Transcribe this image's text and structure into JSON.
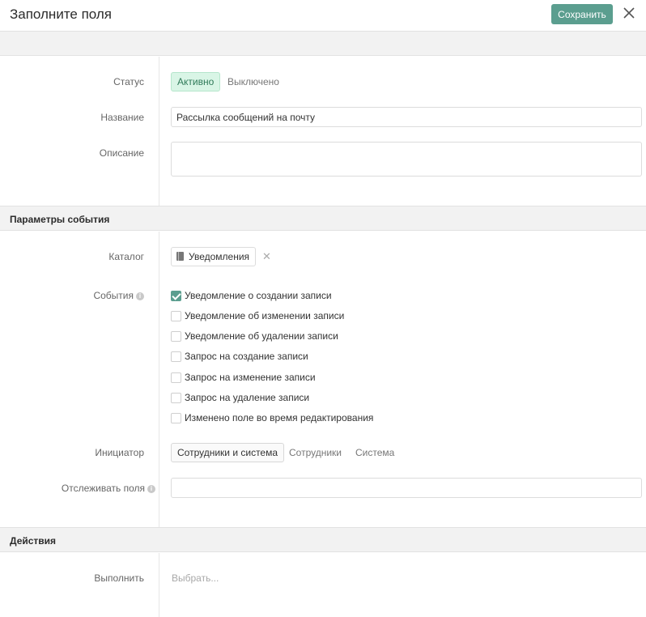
{
  "header": {
    "title": "Заполните поля",
    "save_label": "Сохранить",
    "close_icon": "close-icon"
  },
  "main": {
    "status": {
      "label": "Статус",
      "options": [
        "Активно",
        "Выключено"
      ],
      "selected": "Активно"
    },
    "name": {
      "label": "Название",
      "value": "Рассылка сообщений на почту"
    },
    "description": {
      "label": "Описание",
      "value": ""
    }
  },
  "event_params": {
    "title": "Параметры события",
    "catalog": {
      "label": "Каталог",
      "chip": "Уведомления",
      "chip_icon": "book-icon",
      "remove_icon": "close-icon"
    },
    "events": {
      "label": "События",
      "info_icon": "info-icon",
      "items": [
        {
          "label": "Уведомление о создании записи",
          "checked": true
        },
        {
          "label": "Уведомление об изменении записи",
          "checked": false
        },
        {
          "label": "Уведомление об удалении записи",
          "checked": false
        },
        {
          "label": "Запрос на создание записи",
          "checked": false
        },
        {
          "label": "Запрос на изменение записи",
          "checked": false
        },
        {
          "label": "Запрос на удаление записи",
          "checked": false
        },
        {
          "label": "Изменено поле во время редактирования",
          "checked": false
        }
      ]
    },
    "initiator": {
      "label": "Инициатор",
      "options": [
        "Сотрудники и система",
        "Сотрудники",
        "Система"
      ],
      "selected": "Сотрудники и система"
    },
    "track_fields": {
      "label": "Отслеживать поля",
      "info_icon": "info-icon",
      "value": ""
    }
  },
  "actions": {
    "title": "Действия",
    "execute": {
      "label": "Выполнить",
      "placeholder": "Выбрать..."
    }
  },
  "colors": {
    "accent": "#5b9e8f",
    "active_status_bg": "#d9f5e6",
    "section_bg": "#f2f2f2"
  }
}
